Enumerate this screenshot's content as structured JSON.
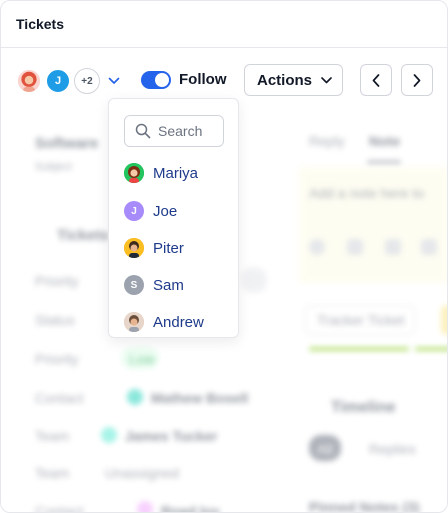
{
  "window": {
    "title": "Tickets"
  },
  "toolbar": {
    "avatars": [
      {
        "name": "avatar-user-1",
        "initial": ""
      },
      {
        "name": "avatar-user-2",
        "initial": "J"
      },
      {
        "name": "avatar-more",
        "initial": "+2"
      }
    ],
    "follow": {
      "label": "Follow",
      "on": true
    },
    "actions_label": "Actions",
    "accent": "#2563eb"
  },
  "dropdown": {
    "search_placeholder": "Search",
    "options": [
      {
        "label": "Mariya",
        "initial": "",
        "color": "#16a34a"
      },
      {
        "label": "Joe",
        "initial": "J",
        "color": "#a78bfa"
      },
      {
        "label": "Piter",
        "initial": "",
        "color": "#f59e0b"
      },
      {
        "label": "Sam",
        "initial": "S",
        "color": "#9ca3af"
      },
      {
        "label": "Andrew",
        "initial": "",
        "color": "#d6b9a6"
      }
    ]
  },
  "background": {
    "left": {
      "heading": "Software",
      "subheading": "Subject",
      "section": "Tickets",
      "rows": [
        "Priority",
        "Status",
        "Priority",
        "Contact",
        "Team",
        "Team",
        "Contact"
      ],
      "values": [
        "Mathew Bosell",
        "James Tucker",
        "Unassigned",
        "Road Ivy"
      ],
      "low_badge": "Low"
    },
    "right": {
      "tabs": [
        "Reply",
        "Note"
      ],
      "note_placeholder": "Add a note here to",
      "tracker_label": "Tracker Ticket",
      "timeline_title": "Timeline",
      "filter_all": "All",
      "filter_replies": "Replies",
      "pinned_label": "Pinned Notes (3)"
    }
  }
}
